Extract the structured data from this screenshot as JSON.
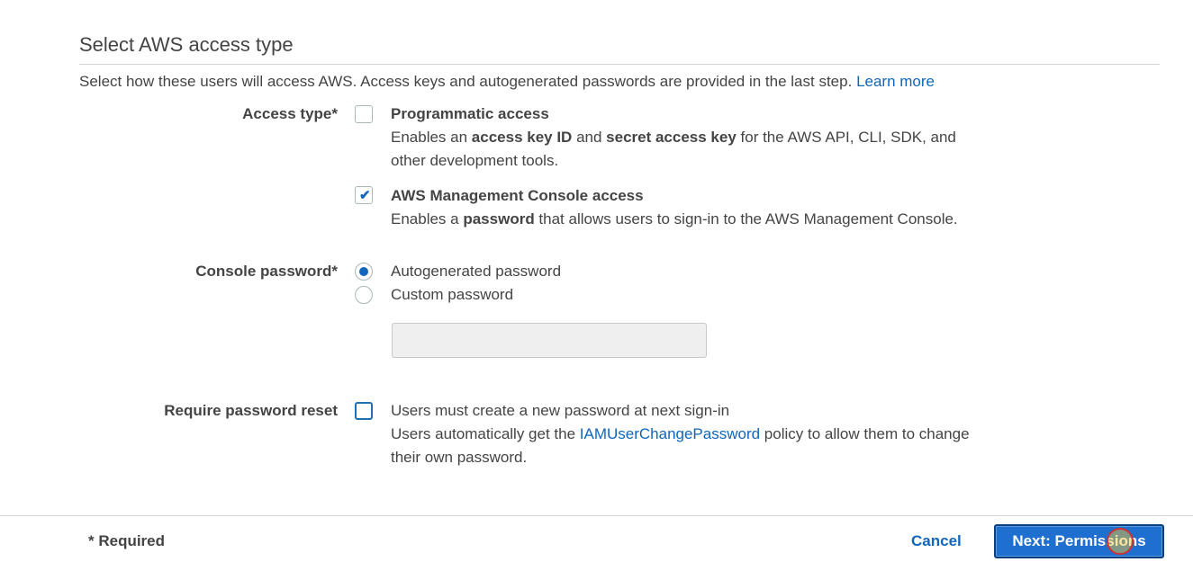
{
  "section": {
    "title": "Select AWS access type",
    "intro": "Select how these users will access AWS. Access keys and autogenerated passwords are provided in the last step.",
    "learn_more": "Learn more"
  },
  "access_type": {
    "label": "Access type*",
    "programmatic": {
      "title": "Programmatic access",
      "checked": false,
      "desc_pre": "Enables an ",
      "desc_b1": "access key ID",
      "desc_mid": " and ",
      "desc_b2": "secret access key",
      "desc_post": " for the AWS API, CLI, SDK, and",
      "desc_line2": "other development tools."
    },
    "console": {
      "title": "AWS Management Console access",
      "checked": true,
      "desc_pre": "Enables a ",
      "desc_b": "password",
      "desc_post": " that allows users to sign-in to the AWS Management Console."
    }
  },
  "console_password": {
    "label": "Console password*",
    "options": [
      "Autogenerated password",
      "Custom password"
    ],
    "selected": "Autogenerated password",
    "custom_value": ""
  },
  "password_reset": {
    "label": "Require password reset",
    "checked": false,
    "text_line1": "Users must create a new password at next sign-in",
    "text_line2_pre": "Users automatically get the ",
    "text_line2_link": "IAMUserChangePassword",
    "text_line2_post": " policy to allow them to change",
    "text_line3": "their own password."
  },
  "footer": {
    "required": "* Required",
    "cancel": "Cancel",
    "next": "Next: Permissions"
  },
  "colors": {
    "link": "#1166bb",
    "primary_button": "#1f6fd0",
    "text": "#444444"
  }
}
